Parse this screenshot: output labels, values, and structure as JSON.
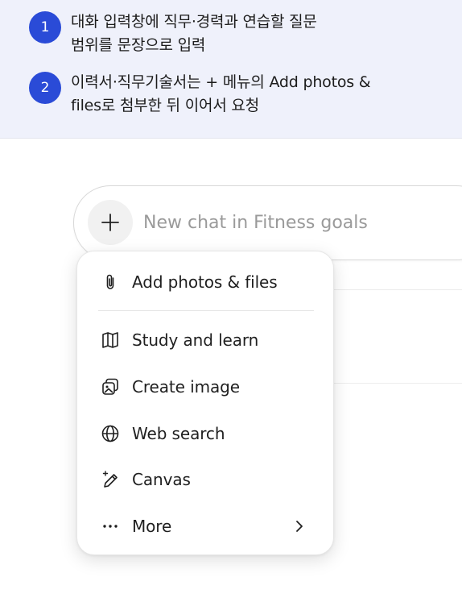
{
  "steps": [
    {
      "number": "1",
      "text": "대화 입력창에 직무·경력과 연습할 질문\n범위를 문장으로 입력"
    },
    {
      "number": "2",
      "text": "이력서·직무기술서는 + 메뉴의 Add photos &\nfiles로 첨부한 뒤 이어서 요청"
    }
  ],
  "composer": {
    "plus_icon": "plus-icon",
    "placeholder": "New chat in Fitness goals"
  },
  "menu": {
    "items": [
      {
        "label": "Add photos & files",
        "icon": "paperclip-icon"
      },
      {
        "label": "Study and learn",
        "icon": "book-icon"
      },
      {
        "label": "Create image",
        "icon": "image-icon"
      },
      {
        "label": "Web search",
        "icon": "globe-icon"
      },
      {
        "label": "Canvas",
        "icon": "pen-sparkle-icon"
      },
      {
        "label": "More",
        "icon": "ellipsis-icon",
        "has_submenu": true
      }
    ]
  },
  "colors": {
    "banner_bg": "#eff1fb",
    "step_badge": "#2a4bd7",
    "placeholder": "#9a9a9a"
  }
}
